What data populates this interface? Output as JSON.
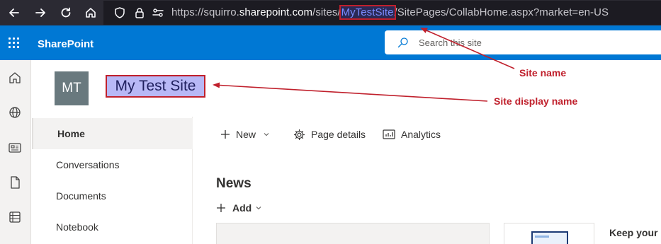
{
  "browser": {
    "url_prefix": "https://squirro.",
    "url_domain": "sharepoint.com",
    "url_path_before": "/sites/",
    "url_site": "MyTestSite",
    "url_path_after": "/SitePages/CollabHome.aspx?market=en-US"
  },
  "suite_bar": {
    "brand": "SharePoint",
    "search_placeholder": "Search this site"
  },
  "site": {
    "logo_initials": "MT",
    "title": "My Test Site"
  },
  "nav": {
    "items": [
      {
        "label": "Home"
      },
      {
        "label": "Conversations"
      },
      {
        "label": "Documents"
      },
      {
        "label": "Notebook"
      }
    ]
  },
  "command_bar": {
    "new_label": "New",
    "page_details_label": "Page details",
    "analytics_label": "Analytics"
  },
  "news": {
    "title": "News",
    "add_label": "Add",
    "card_b_heading": "Keep your"
  },
  "annotations": {
    "site_name": "Site name",
    "site_display_name": "Site display name"
  },
  "colors": {
    "brand_blue": "#0078d4",
    "annotation_red": "#c0202c",
    "highlight": "#b8b8f6"
  }
}
